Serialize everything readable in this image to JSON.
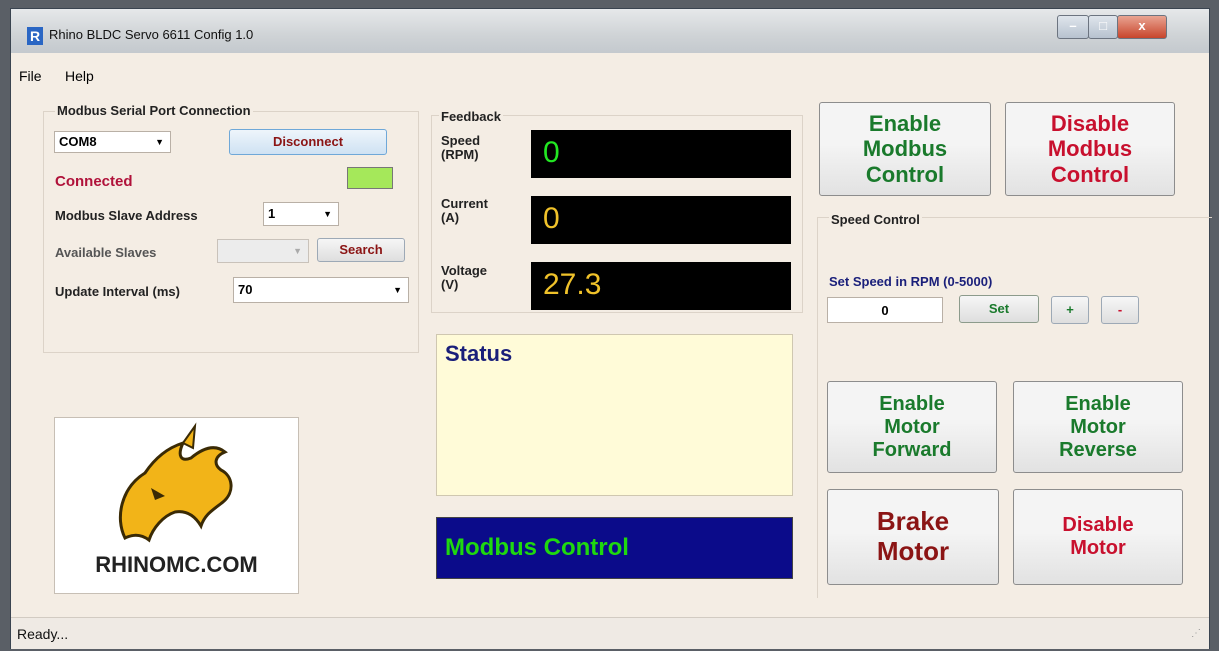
{
  "window": {
    "title": "Rhino BLDC Servo 6611 Config 1.0",
    "icon_letter": "R",
    "minimize": "–",
    "maximize": "□",
    "close": "x"
  },
  "menu": {
    "file": "File",
    "help": "Help"
  },
  "connection": {
    "group_title": "Modbus Serial Port Connection",
    "port": "COM8",
    "disconnect_label": "Disconnect",
    "status": "Connected",
    "status_color": "#b0123a",
    "indicator_color": "#a5e85a",
    "slave_address_label": "Modbus Slave Address",
    "slave_address": "1",
    "available_slaves_label": "Available Slaves",
    "search_label": "Search",
    "update_interval_label": "Update Interval (ms)",
    "update_interval": "70"
  },
  "logo": {
    "text": "RHINOMC.COM"
  },
  "feedback": {
    "group_title": "Feedback",
    "speed_label": "Speed\n(RPM)",
    "speed_value": "0",
    "current_label": "Current\n(A)",
    "current_value": "0",
    "voltage_label": "Voltage\n(V)",
    "voltage_value": "27.3"
  },
  "status": {
    "title": "Status",
    "mode": "Modbus Control",
    "mode_color": "#1fd80f"
  },
  "modbus_control": {
    "enable_label": "Enable\nModbus\nControl",
    "disable_label": "Disable\nModbus\nControl"
  },
  "speed_control": {
    "group_title": "Speed Control",
    "set_label": "Set Speed in RPM (0-5000)",
    "value": "0",
    "set_button": "Set",
    "plus": "+",
    "minus": "-"
  },
  "motor": {
    "forward_label": "Enable\nMotor\nForward",
    "reverse_label": "Enable\nMotor\nReverse",
    "brake_label": "Brake\nMotor",
    "disable_label": "Disable\nMotor"
  },
  "statusbar": {
    "text": "Ready..."
  },
  "colors": {
    "green": "#1a7a2c",
    "red": "#c8102e",
    "darkred": "#8b1414"
  }
}
